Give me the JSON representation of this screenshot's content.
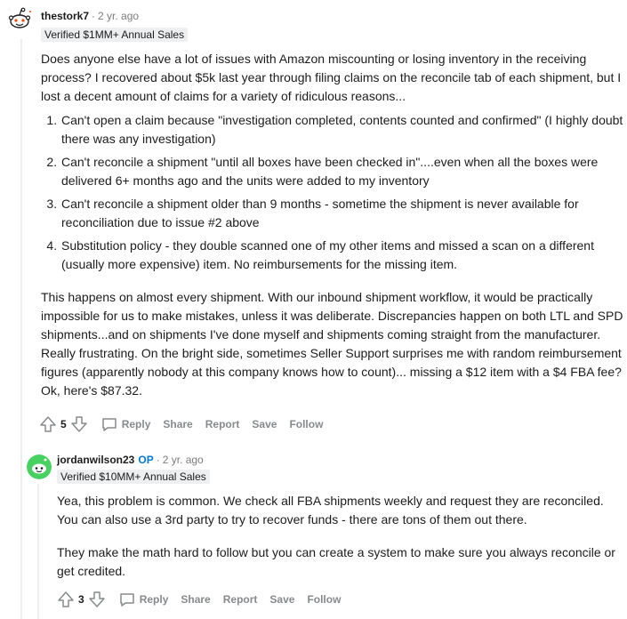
{
  "comment1": {
    "author": "thestork7",
    "time": "2 yr. ago",
    "flair": "Verified $1MM+ Annual Sales",
    "para1": "Does anyone else have a lot of issues with Amazon miscounting or losing inventory in the receiving process? I recovered about $5k last year through filing claims on the reconcile tab of each shipment, but I lost a decent amount of claims for a variety of ridiculous reasons...",
    "list": [
      "Can't open a claim because \"investigation completed, contents counted and confirmed\" (I highly doubt there was any investigation)",
      "Can't reconcile a shipment \"until all boxes have been checked in\"....even when all the boxes were delivered 6+ months ago and the units were added to my inventory",
      "Can't reconcile a shipment older than 9 months - sometime the shipment is never available for reconciliation due to issue #2 above",
      "Substitution policy - they double scanned one of my other items and missed a scan on a different (usually more expensive) item. No reimbursements for the missing item."
    ],
    "para2": "This happens on almost every shipment. With our inbound shipment workflow, it would be practically impossible for us to make mistakes, unless it was deliberate. Discrepancies happen on both LTL and SPD shipments...and on shipments I've done myself and shipments coming straight from the manufacturer. Really frustrating. On the bright side, sometimes Seller Support surprises me with random reimbursement figures (apparently nobody at this company knows how to count)... missing a $12 item with a $4 FBA fee? Ok, here's $87.32.",
    "score": "5",
    "actions": {
      "reply": "Reply",
      "share": "Share",
      "report": "Report",
      "save": "Save",
      "follow": "Follow"
    }
  },
  "comment2": {
    "author": "jordanwilson23",
    "op_badge": "OP",
    "time": "2 yr. ago",
    "flair": "Verified $10MM+ Annual Sales",
    "para1": "Yea, this problem is common. We check all FBA shipments weekly and request they are reconciled. You can also use a 3rd party to try to recover funds - there are tons of them out there.",
    "para2": "They make the math hard to follow but you can create a system to make sure you always reconcile or get credited.",
    "score": "3",
    "actions": {
      "reply": "Reply",
      "share": "Share",
      "report": "Report",
      "save": "Save",
      "follow": "Follow"
    }
  },
  "icons": [
    "snoo-avatar-icon",
    "upvote-icon",
    "downvote-icon",
    "comment-icon"
  ]
}
